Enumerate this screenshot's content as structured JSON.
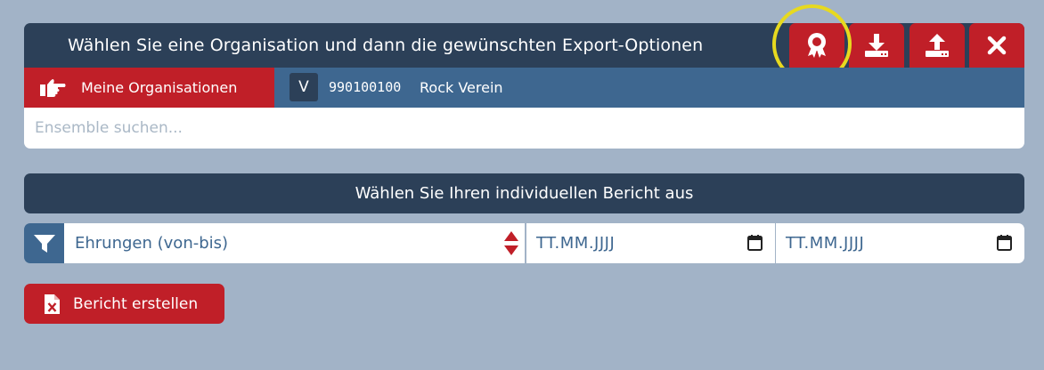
{
  "header": {
    "title": "Wählen Sie eine Organisation und dann die gewünschten Export-Optionen",
    "buttons": [
      {
        "name": "award-icon"
      },
      {
        "name": "download-icon"
      },
      {
        "name": "upload-icon"
      },
      {
        "name": "close-icon"
      }
    ]
  },
  "organisations": {
    "button_label": "Meine Organisationen",
    "selected": {
      "badge": "V",
      "number": "990100100",
      "name": "Rock Verein"
    }
  },
  "search": {
    "placeholder": "Ensemble suchen..."
  },
  "report": {
    "header": "Wählen Sie Ihren individuellen Bericht aus",
    "select_value": "Ehrungen (von-bis)",
    "date_from": "TT.MM.JJJJ",
    "date_to": "TT.MM.JJJJ",
    "create_label": "Bericht erstellen"
  },
  "colors": {
    "primary": "#2c4058",
    "accent": "#c01f28",
    "secondary": "#3e6790",
    "background": "#a2b3c7",
    "highlight": "#e7d91f"
  }
}
